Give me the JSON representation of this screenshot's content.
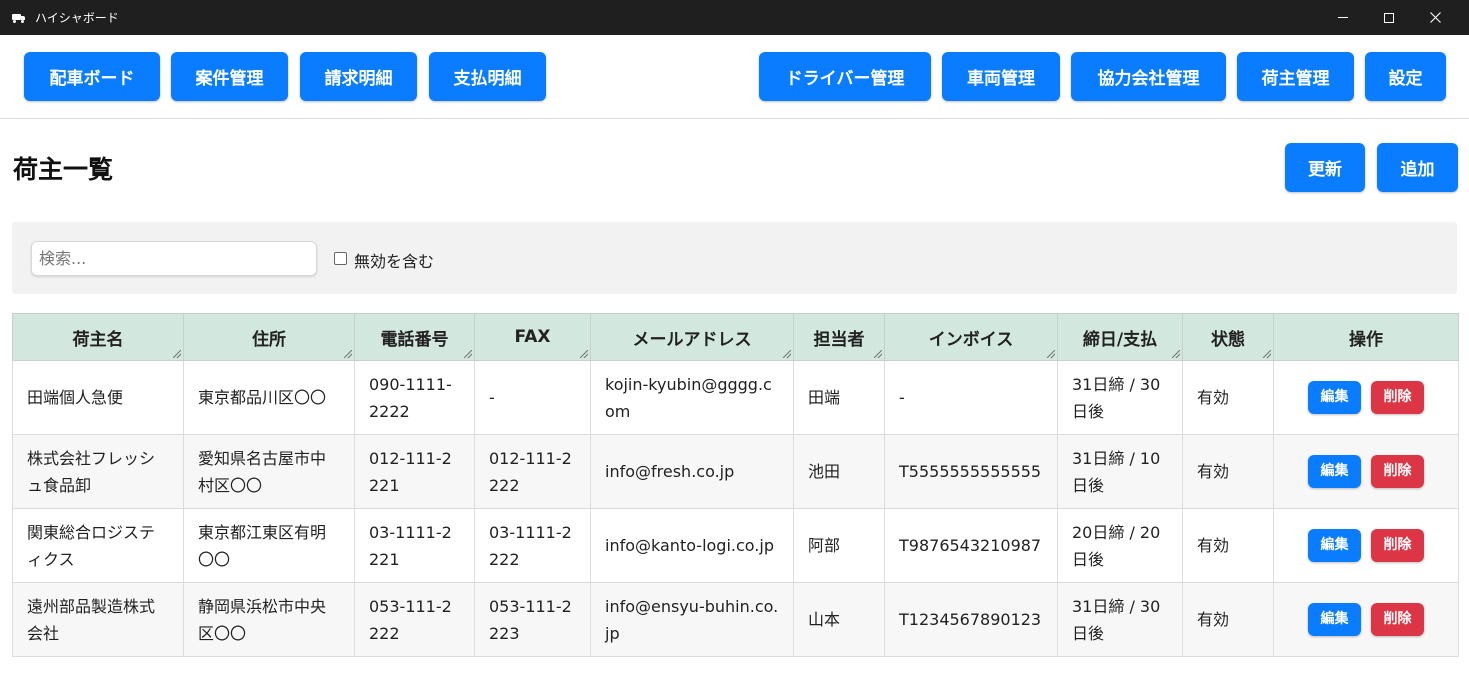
{
  "window": {
    "title": "ハイシャボード",
    "app_icon": "truck-icon"
  },
  "nav": {
    "left": [
      "配車ボード",
      "案件管理",
      "請求明細",
      "支払明細"
    ],
    "right": [
      "ドライバー管理",
      "車両管理",
      "協力会社管理",
      "荷主管理",
      "設定"
    ]
  },
  "page": {
    "title": "荷主一覧",
    "refresh_label": "更新",
    "add_label": "追加"
  },
  "filter": {
    "search_placeholder": "検索...",
    "search_value": "",
    "include_inactive_label": "無効を含む",
    "include_inactive_checked": false
  },
  "table": {
    "headers": [
      "荷主名",
      "住所",
      "電話番号",
      "FAX",
      "メールアドレス",
      "担当者",
      "インボイス",
      "締日/支払",
      "状態",
      "操作"
    ],
    "rows": [
      {
        "name": "田端個人急便",
        "address": "東京都品川区〇〇",
        "phone": "090-1111-2222",
        "fax": "-",
        "email": "kojin-kyubin@gggg.com",
        "person": "田端",
        "invoice": "-",
        "closing": "31日締 / 30日後",
        "status": "有効"
      },
      {
        "name": "株式会社フレッシュ食品卸",
        "address": "愛知県名古屋市中村区〇〇",
        "phone": "012-111-2221",
        "fax": "012-111-2222",
        "email": "info@fresh.co.jp",
        "person": "池田",
        "invoice": "T5555555555555",
        "closing": "31日締 / 10日後",
        "status": "有効"
      },
      {
        "name": "関東総合ロジスティクス",
        "address": "東京都江東区有明〇〇",
        "phone": "03-1111-2221",
        "fax": "03-1111-2222",
        "email": "info@kanto-logi.co.jp",
        "person": "阿部",
        "invoice": "T9876543210987",
        "closing": "20日締 / 20日後",
        "status": "有効"
      },
      {
        "name": "遠州部品製造株式会社",
        "address": "静岡県浜松市中央区〇〇",
        "phone": "053-111-2222",
        "fax": "053-111-2223",
        "email": "info@ensyu-buhin.co.jp",
        "person": "山本",
        "invoice": "T1234567890123",
        "closing": "31日締 / 30日後",
        "status": "有効"
      }
    ],
    "edit_label": "編集",
    "delete_label": "削除"
  },
  "colors": {
    "primary": "#0a7cff",
    "danger": "#dc3545",
    "success": "#1a8a1a",
    "header_bg": "#d2e7de",
    "titlebar": "#1f1f1f"
  }
}
